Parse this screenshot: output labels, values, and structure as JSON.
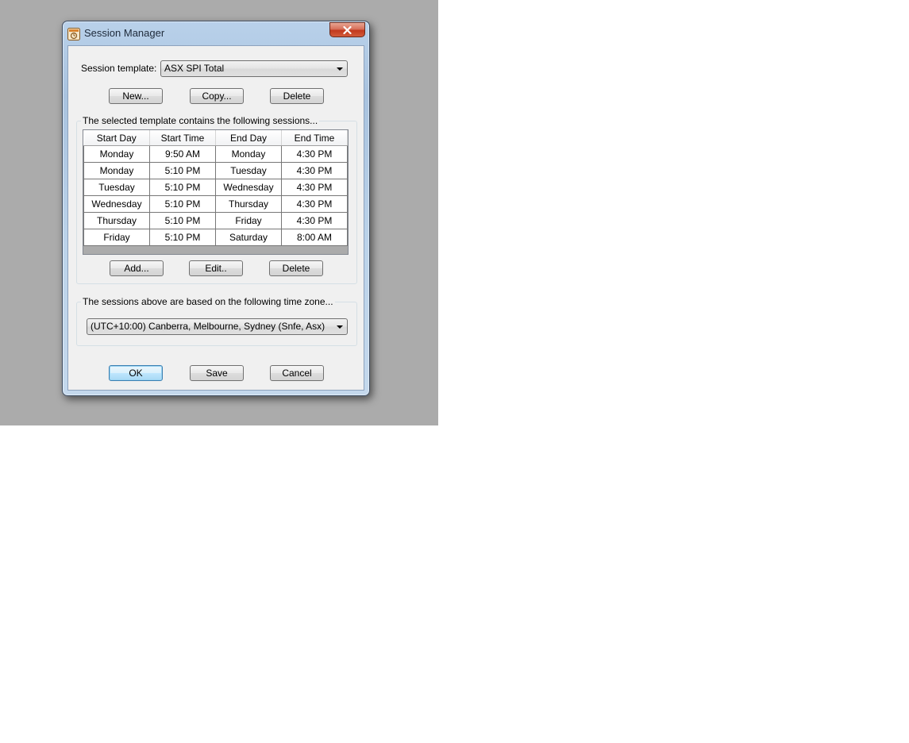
{
  "window": {
    "title": "Session Manager",
    "close_glyph": "✕"
  },
  "template": {
    "label": "Session template:",
    "selected": "ASX SPI Total"
  },
  "template_buttons": {
    "new": "New...",
    "copy": "Copy...",
    "delete": "Delete"
  },
  "sessions": {
    "group_label": "The selected template contains the following sessions...",
    "columns": [
      "Start Day",
      "Start Time",
      "End Day",
      "End Time"
    ],
    "rows": [
      [
        "Monday",
        "9:50 AM",
        "Monday",
        "4:30 PM"
      ],
      [
        "Monday",
        "5:10 PM",
        "Tuesday",
        "4:30 PM"
      ],
      [
        "Tuesday",
        "5:10 PM",
        "Wednesday",
        "4:30 PM"
      ],
      [
        "Wednesday",
        "5:10 PM",
        "Thursday",
        "4:30 PM"
      ],
      [
        "Thursday",
        "5:10 PM",
        "Friday",
        "4:30 PM"
      ],
      [
        "Friday",
        "5:10 PM",
        "Saturday",
        "8:00 AM"
      ]
    ],
    "add": "Add...",
    "edit": "Edit..",
    "delete": "Delete"
  },
  "timezone": {
    "group_label": "The sessions above are based on the following time zone...",
    "selected": "(UTC+10:00) Canberra, Melbourne, Sydney (Snfe, Asx)"
  },
  "footer": {
    "ok": "OK",
    "save": "Save",
    "cancel": "Cancel"
  }
}
